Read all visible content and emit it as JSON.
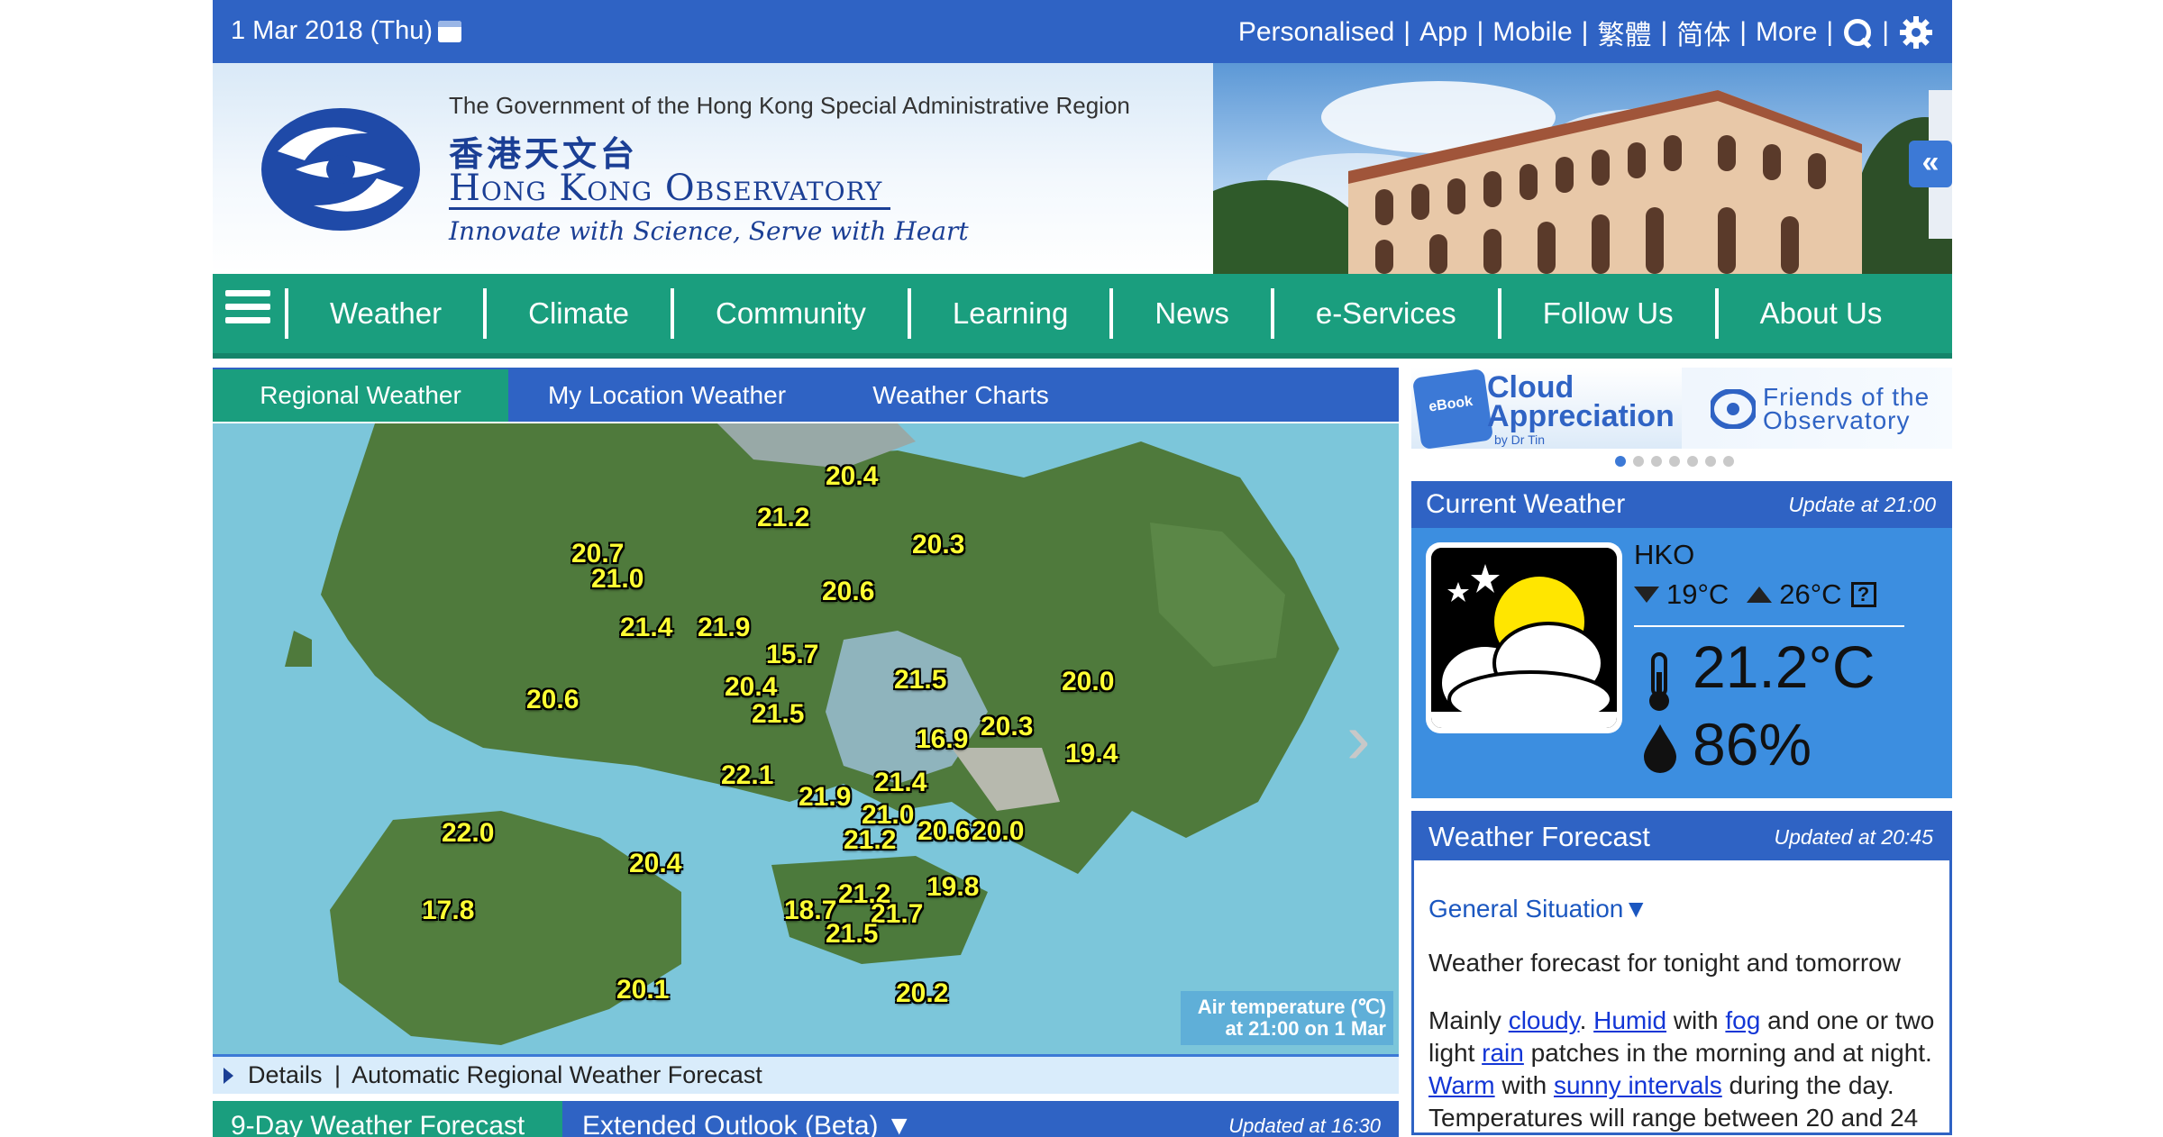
{
  "topbar": {
    "date": "1 Mar 2018 (Thu)",
    "links": [
      "Personalised",
      "App",
      "Mobile",
      "繁體",
      "简体",
      "More"
    ],
    "calendar_icon": "calendar-icon",
    "search_icon": "search-icon",
    "settings_icon": "gear-icon"
  },
  "banner": {
    "gov_text": "The Government of the Hong Kong Special Administrative Region",
    "chinese_name": "香港天文台",
    "org_name": "Hong Kong Observatory",
    "motto": "Innovate with Science, Serve with Heart",
    "collapse_label": "«"
  },
  "nav": {
    "items": [
      "Weather",
      "Climate",
      "Community",
      "Learning",
      "News",
      "e-Services",
      "Follow Us",
      "About Us"
    ]
  },
  "tabs": [
    "Regional Weather",
    "My Location Weather",
    "Weather Charts"
  ],
  "map": {
    "temperatures": [
      "20.4",
      "21.2",
      "20.7",
      "21.0",
      "20.3",
      "20.6",
      "21.4",
      "21.9",
      "15.7",
      "20.4",
      "21.5",
      "21.5",
      "20.0",
      "20.6",
      "16.9",
      "20.3",
      "19.4",
      "22.1",
      "21.4",
      "21.9",
      "21.0",
      "21.2",
      "20.6",
      "20.0",
      "22.0",
      "20.4",
      "17.8",
      "18.7",
      "21.2",
      "21.7",
      "19.8",
      "21.5",
      "20.1",
      "20.2"
    ],
    "legend_line1": "Air temperature (℃)",
    "legend_line2": "at 21:00 on 1 Mar"
  },
  "details": {
    "label": "Details",
    "link": "Automatic Regional Weather Forecast"
  },
  "bottom_tabs": {
    "tab1": "9-Day Weather Forecast",
    "tab2": "Extended Outlook (Beta) ▼",
    "updated": "Updated at 16:30"
  },
  "promo": {
    "cloud_title_1": "Cloud",
    "cloud_title_2": "Appreciation",
    "cloud_by": "by Dr Tin",
    "ebook": "eBook",
    "friends_1": "Friends of the",
    "friends_2": "Observatory",
    "dots_total": 7,
    "dots_active": 0
  },
  "current_weather": {
    "title": "Current Weather",
    "updated": "Update at 21:00",
    "station": "HKO",
    "min": "19°C",
    "max": "26°C",
    "help": "?",
    "temperature": "21.2°C",
    "humidity": "86%",
    "icon": "partly-cloudy-night-icon"
  },
  "forecast": {
    "title": "Weather Forecast",
    "updated": "Updated at 20:45",
    "general_situation": "General Situation▼",
    "subtitle": "Weather forecast for tonight and tomorrow",
    "segments": [
      {
        "t": "Mainly ",
        "link": false
      },
      {
        "t": "cloudy",
        "link": true
      },
      {
        "t": ". ",
        "link": false
      },
      {
        "t": "Humid",
        "link": true
      },
      {
        "t": " with ",
        "link": false
      },
      {
        "t": "fog",
        "link": true
      },
      {
        "t": " and one or two light ",
        "link": false
      },
      {
        "t": "rain",
        "link": true
      },
      {
        "t": " patches in the morning and at night. ",
        "link": false
      },
      {
        "t": "Warm",
        "link": true
      },
      {
        "t": " with ",
        "link": false
      },
      {
        "t": "sunny intervals",
        "link": true
      },
      {
        "t": " during the day. Temperatures will range between 20 and 24",
        "link": false
      }
    ]
  },
  "colors": {
    "primary_blue": "#2f63c4",
    "green": "#1a9e7e",
    "light_blue": "#3c8ee0",
    "temp_yellow": "#ffff33"
  }
}
